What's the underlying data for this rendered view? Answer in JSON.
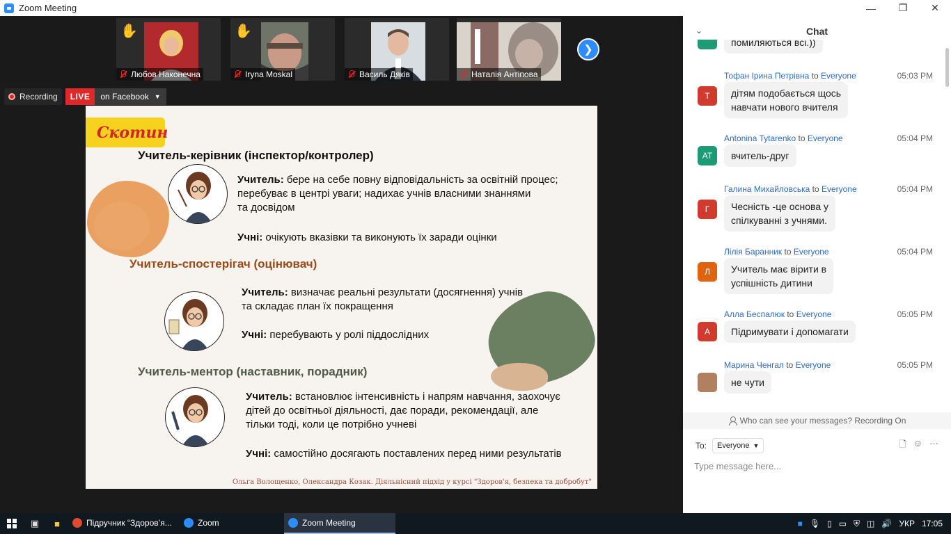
{
  "window": {
    "title": "Zoom Meeting",
    "minimize": "—",
    "maximize": "❐",
    "close": "✕"
  },
  "participants": [
    {
      "name": "Любов Наконечна",
      "hand": "✋"
    },
    {
      "name": "Iryna Moskal",
      "hand": "✋"
    },
    {
      "name": "Василь Дяків",
      "hand": ""
    },
    {
      "name": "Наталія Антіпова",
      "hand": ""
    }
  ],
  "next_arrow": "❯",
  "recording": {
    "label": "Recording",
    "live": "LIVE",
    "destination": "on Facebook"
  },
  "slide": {
    "logo": "Скотин",
    "sections": [
      {
        "header": "Учитель-керівник (інспектор/контролер)",
        "header_color": "#111111",
        "teacher_label": "Учитель:",
        "teacher_text_1": " бере на себе повну відповідальність за освітній процес;",
        "teacher_text_2": "перебуває в центрі уваги; надихає учнів власними знаннями",
        "teacher_text_3": "та досвідом",
        "students_label": "Учні:",
        "students_text": " очікують вказівки та виконують їх заради оцінки"
      },
      {
        "header": "Учитель-спостерігач (оцінювач)",
        "header_color": "#9a4a16",
        "teacher_label": "Учитель:",
        "teacher_text_1": "  визначає реальні результати (досягнення) учнів",
        "teacher_text_2": "та  складає план їх покращення",
        "students_label": "Учні:",
        "students_text": " перебувають у ролі піддослідних"
      },
      {
        "header": "Учитель-ментор (наставник, порадник)",
        "header_color": "#4f5a48",
        "teacher_label": "Учитель:",
        "teacher_text_1": "  встановлює інтенсивність і напрям  навчання,  заохочує",
        "teacher_text_2": "дітей до освітньої діяльності, дає поради, рекомендації, але",
        "teacher_text_3": "тільки тоді, коли це потрібно учневі",
        "students_label": "Учні:",
        "students_text": " самостійно досягають поставлених перед ними результатів"
      }
    ],
    "citation": "Ольга Волощенко, Олександра Козак. Діяльнісний підхід у курсі \"Здоров'я, безпека та добробут\""
  },
  "chat": {
    "title": "Chat",
    "partial_message": "помиляються всі.))",
    "messages": [
      {
        "sender": "Тофан Ірина Петрівна",
        "to": "to",
        "recipient": "Everyone",
        "time": "05:03 PM",
        "initials": "Т",
        "color": "#d13b2f",
        "line1": "дітям подобається щось",
        "line2": "навчати нового вчителя"
      },
      {
        "sender": "Antonina Tytarenko",
        "to": "to",
        "recipient": "Everyone",
        "time": "05:04 PM",
        "initials": "AT",
        "color": "#1e9b74",
        "line1": "вчитель-друг",
        "line2": ""
      },
      {
        "sender": "Галина Михайловська",
        "to": "to",
        "recipient": "Everyone",
        "time": "05:04 PM",
        "initials": "Г",
        "color": "#d13b2f",
        "line1": "Чесність -це основа у",
        "line2": "спілкуванні з учнями."
      },
      {
        "sender": "Лілія Баранник",
        "to": "to",
        "recipient": "Everyone",
        "time": "05:04 PM",
        "initials": "Л",
        "color": "#e06410",
        "line1": "Учитель має вірити в",
        "line2": "успішність дитини"
      },
      {
        "sender": "Алла Беспалюк",
        "to": "to",
        "recipient": "Everyone",
        "time": "05:05 PM",
        "initials": "А",
        "color": "#d13b2f",
        "line1": "Підримувати і допомагати",
        "line2": ""
      },
      {
        "sender": "Марина Ченгал",
        "to": "to",
        "recipient": "Everyone",
        "time": "05:05 PM",
        "initials": "",
        "color": "#b08060",
        "line1": "не чути",
        "line2": ""
      }
    ],
    "visibility_note": "Who can see your messages? Recording On",
    "to_label": "To:",
    "to_value": "Everyone",
    "file_icon": "🗋",
    "emoji_icon": "☺",
    "more_icon": "···",
    "input_placeholder": "Type message here..."
  },
  "taskbar": {
    "apps": [
      {
        "label": "Підручник “Здоров’я...",
        "color": "#e04a2f",
        "active": false
      },
      {
        "label": "Zoom",
        "color": "#2d8cff",
        "active": false
      },
      {
        "label": "Zoom Meeting",
        "color": "#2d8cff",
        "active": true
      }
    ],
    "language": "УКР",
    "clock": "17:05"
  }
}
